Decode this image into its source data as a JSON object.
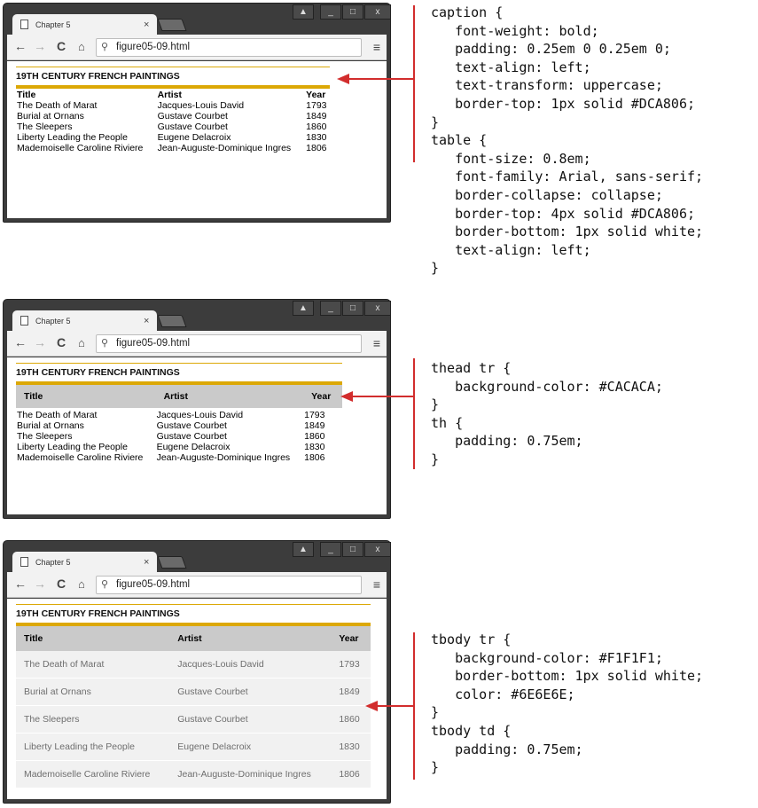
{
  "browser": {
    "tab_title": "Chapter 5",
    "tab_close": "×",
    "url": "figure05-09.html",
    "back": "←",
    "forward": "→",
    "reload": "C",
    "home": "⌂",
    "menu": "≡",
    "search_glyph": "⚲",
    "window_user": "▲",
    "window_min": "_",
    "window_max": "□",
    "window_close": "x"
  },
  "table": {
    "caption": "19th Century French Paintings",
    "headers": {
      "title": "Title",
      "artist": "Artist",
      "year": "Year"
    },
    "rows": [
      {
        "title": "The Death of Marat",
        "artist": "Jacques-Louis David",
        "year": "1793"
      },
      {
        "title": "Burial at Ornans",
        "artist": "Gustave Courbet",
        "year": "1849"
      },
      {
        "title": "The Sleepers",
        "artist": "Gustave Courbet",
        "year": "1860"
      },
      {
        "title": "Liberty Leading the People",
        "artist": "Eugene Delacroix",
        "year": "1830"
      },
      {
        "title": "Mademoiselle Caroline Riviere",
        "artist": "Jean-Auguste-Dominique Ingres",
        "year": "1806"
      }
    ]
  },
  "code": {
    "block1": "caption {\n   font-weight: bold;\n   padding: 0.25em 0 0.25em 0;\n   text-align: left;\n   text-transform: uppercase;\n   border-top: 1px solid #DCA806;\n}\ntable {\n   font-size: 0.8em;\n   font-family: Arial, sans-serif;\n   border-collapse: collapse;\n   border-top: 4px solid #DCA806;\n   border-bottom: 1px solid white;\n   text-align: left;\n}",
    "block2": "thead tr {\n   background-color: #CACACA;\n}\nth {\n   padding: 0.75em;\n}",
    "block3": "tbody tr {\n   background-color: #F1F1F1;\n   border-bottom: 1px solid white;\n   color: #6E6E6E;\n}\ntbody td {\n   padding: 0.75em;\n}"
  },
  "colors": {
    "caption_border": "#DCA806",
    "thead_bg": "#CACACA",
    "tbody_bg": "#F1F1F1",
    "tbody_text": "#6E6E6E",
    "arrow": "#d22d2d"
  }
}
